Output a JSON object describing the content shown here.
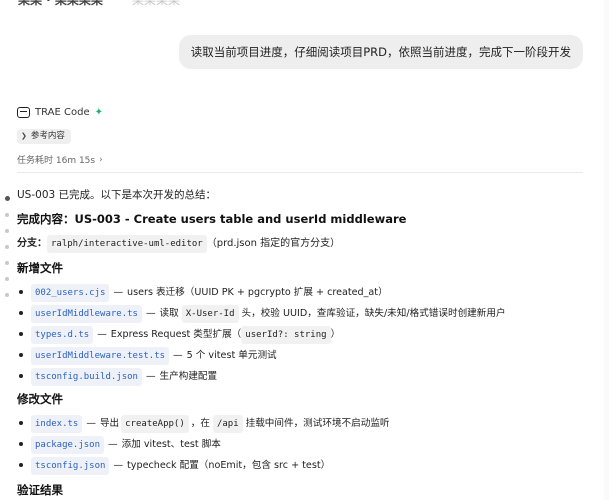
{
  "topbar": {
    "cut_left": "某某 · 某某某某",
    "cut_right": "某某某某"
  },
  "user_message": "读取当前项目进度，仔细阅读项目PRD，依照当前进度，完成下一阶段开发",
  "assistant": {
    "name": "TRAE Code",
    "ref_chip": "参考内容",
    "elapsed": "任务耗时 16m 15s"
  },
  "summary": {
    "intro": "US-003 已完成。以下是本次开发的总结：",
    "done_label": "完成内容：",
    "done_value": "US-003 - Create users table and userId middleware",
    "branch_label": "分支：",
    "branch_code": "ralph/interactive-uml-editor",
    "branch_note": "（prd.json 指定的官方分支）"
  },
  "new_files": {
    "title": "新增文件",
    "items": [
      {
        "file": "002_users.cjs",
        "dash": "—",
        "pre": "users 表迁移（UUID PK + pgcrypto 扩展 + created_at）",
        "code": "",
        "post": ""
      },
      {
        "file": "userIdMiddleware.ts",
        "dash": "—",
        "pre": "读取",
        "code": "X-User-Id",
        "post": "头，校验 UUID，查库验证，缺失/未知/格式错误时创建新用户"
      },
      {
        "file": "types.d.ts",
        "dash": "—",
        "pre": "Express Request 类型扩展（",
        "code": "userId?: string",
        "post": "）"
      },
      {
        "file": "userIdMiddleware.test.ts",
        "dash": "—",
        "pre": "5 个 vitest 单元测试",
        "code": "",
        "post": ""
      },
      {
        "file": "tsconfig.build.json",
        "dash": "—",
        "pre": "生产构建配置",
        "code": "",
        "post": ""
      }
    ]
  },
  "modified_files": {
    "title": "修改文件",
    "items": [
      {
        "file": "index.ts",
        "dash": "—",
        "pre": "导出",
        "code": "createApp()",
        "post": "，在",
        "code2": "/api",
        "post2": "挂载中间件，测试环境不启动监听"
      },
      {
        "file": "package.json",
        "dash": "—",
        "pre": "添加 vitest、test 脚本",
        "code": "",
        "post": "",
        "code2": "",
        "post2": ""
      },
      {
        "file": "tsconfig.json",
        "dash": "—",
        "pre": "typecheck 配置（noEmit，包含 src + test）",
        "code": "",
        "post": "",
        "code2": "",
        "post2": ""
      }
    ]
  },
  "verify": {
    "title": "验证结果"
  },
  "icons": {
    "logo": "trae-logo-icon",
    "spark": "sparkle-icon",
    "chevron": "chevron-right-icon"
  },
  "colors": {
    "accent_green": "#16b26e",
    "code_file_blue": "#2b5fc0",
    "bubble_bg": "#eeeeee"
  }
}
